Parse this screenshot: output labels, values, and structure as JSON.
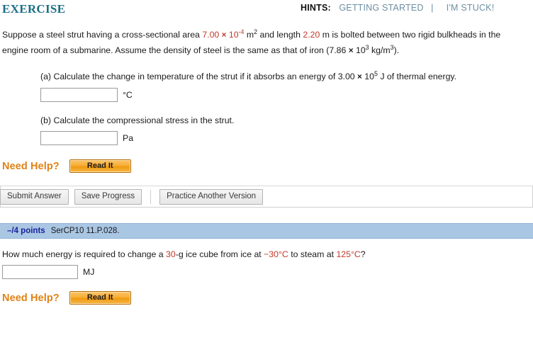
{
  "header": {
    "title": "EXERCISE",
    "hints_label": "HINTS:",
    "hint_getting_started": "GETTING STARTED",
    "hint_separator": "|",
    "hint_im_stuck": "I'M STUCK!",
    "title_color": "#1b6e87",
    "link_color": "#6d8fa3"
  },
  "question1": {
    "stem_part1": "Suppose a steel strut having a cross-sectional area ",
    "area_value": "7.00",
    "times": "×",
    "area_base": "10",
    "area_exponent": "-4",
    "area_unit_m": "m",
    "area_unit_exp": "2",
    "stem_part2": " and length ",
    "length_value": "2.20",
    "stem_part3": " m is bolted between two rigid bulkheads in the engine room of a submarine. Assume the density of steel is the same as that of iron (7.86 ",
    "density_base": "10",
    "density_exponent": "3",
    "stem_part4": " kg/m",
    "density_unit_exp": "3",
    "stem_part5": ").",
    "parts": [
      {
        "text_before": "(a) Calculate the change in temperature of the strut if it absorbs an energy of 3.00 ",
        "energy_base": "10",
        "energy_exponent": "5",
        "text_after": " J of thermal energy.",
        "input_value": "",
        "unit": "°C"
      },
      {
        "text_before": "(b) Calculate the compressional stress in the strut.",
        "energy_base": "",
        "energy_exponent": "",
        "text_after": "",
        "input_value": "",
        "unit": "Pa"
      }
    ],
    "need_help_label": "Need Help?",
    "read_it_label": "Read It"
  },
  "actions": {
    "submit_answer": "Submit Answer",
    "save_progress": "Save Progress",
    "practice_another_version": "Practice Another Version"
  },
  "question2": {
    "points": "–/4 points",
    "code": "SerCP10 11.P.028.",
    "stem_part1": "How much energy is required to change a ",
    "mass_value": "30",
    "stem_part2": "-g ice cube from ice at  ",
    "temp_start": "−30°C",
    "stem_part3": "  to steam at ",
    "temp_end": "125°C",
    "stem_part4": "?",
    "input_value": "",
    "unit": "MJ",
    "need_help_label": "Need Help?",
    "read_it_label": "Read It"
  },
  "colors": {
    "red_value": "#c0392b",
    "orange_accent": "#e08214",
    "banner_blue": "#a9c6e3",
    "points_blue": "#18239e"
  }
}
